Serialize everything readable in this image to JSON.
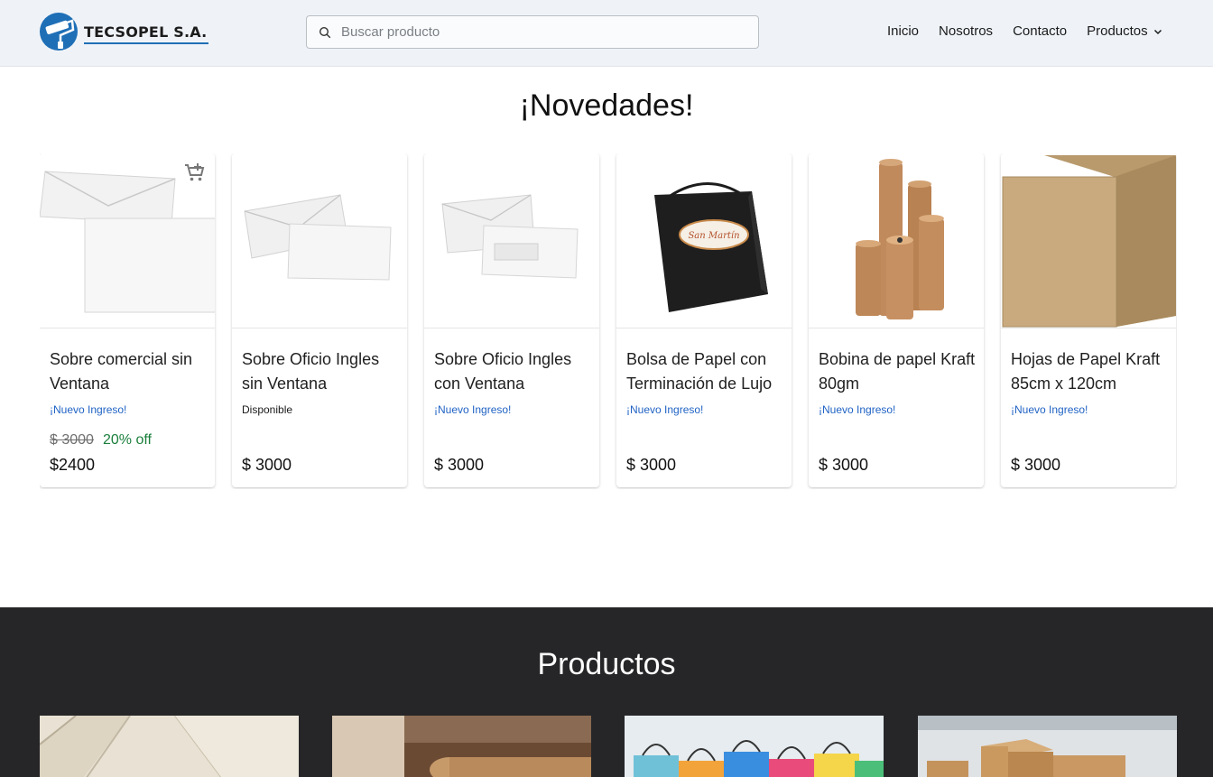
{
  "header": {
    "brand": "TECSOPEL S.A.",
    "search_placeholder": "Buscar producto",
    "nav": [
      "Inicio",
      "Nosotros",
      "Contacto"
    ],
    "nav_dropdown": "Productos"
  },
  "novedades": {
    "title": "¡Novedades!",
    "cards": [
      {
        "title": "Sobre comercial sin Ventana",
        "status": "¡Nuevo Ingreso!",
        "old_price": "$ 3000",
        "discount": "20% off",
        "price": "$2400"
      },
      {
        "title": "Sobre Oficio Ingles sin Ventana",
        "status": "Disponible",
        "price": "$ 3000"
      },
      {
        "title": "Sobre Oficio Ingles con Ventana",
        "status": "¡Nuevo Ingreso!",
        "price": "$ 3000"
      },
      {
        "title": "Bolsa de Papel con Terminación de Lujo",
        "status": "¡Nuevo Ingreso!",
        "price": "$ 3000",
        "bag_label": "San Martín"
      },
      {
        "title": "Bobina de papel Kraft 80gm",
        "status": "¡Nuevo Ingreso!",
        "price": "$ 3000"
      },
      {
        "title": "Hojas de Papel Kraft 85cm x 120cm",
        "status": "¡Nuevo Ingreso!",
        "price": "$ 3000"
      }
    ]
  },
  "productos": {
    "title": "Productos",
    "categories": [
      "sobres-image",
      "papel-kraft-image",
      "bolsas-image",
      "cajas-image"
    ]
  },
  "colors": {
    "header_bg": "#eff3f8",
    "new_ingreso": "#1f62c4",
    "discount": "#1a7f3c",
    "products_bg": "#262628",
    "brand_blue": "#1f6fb6"
  }
}
